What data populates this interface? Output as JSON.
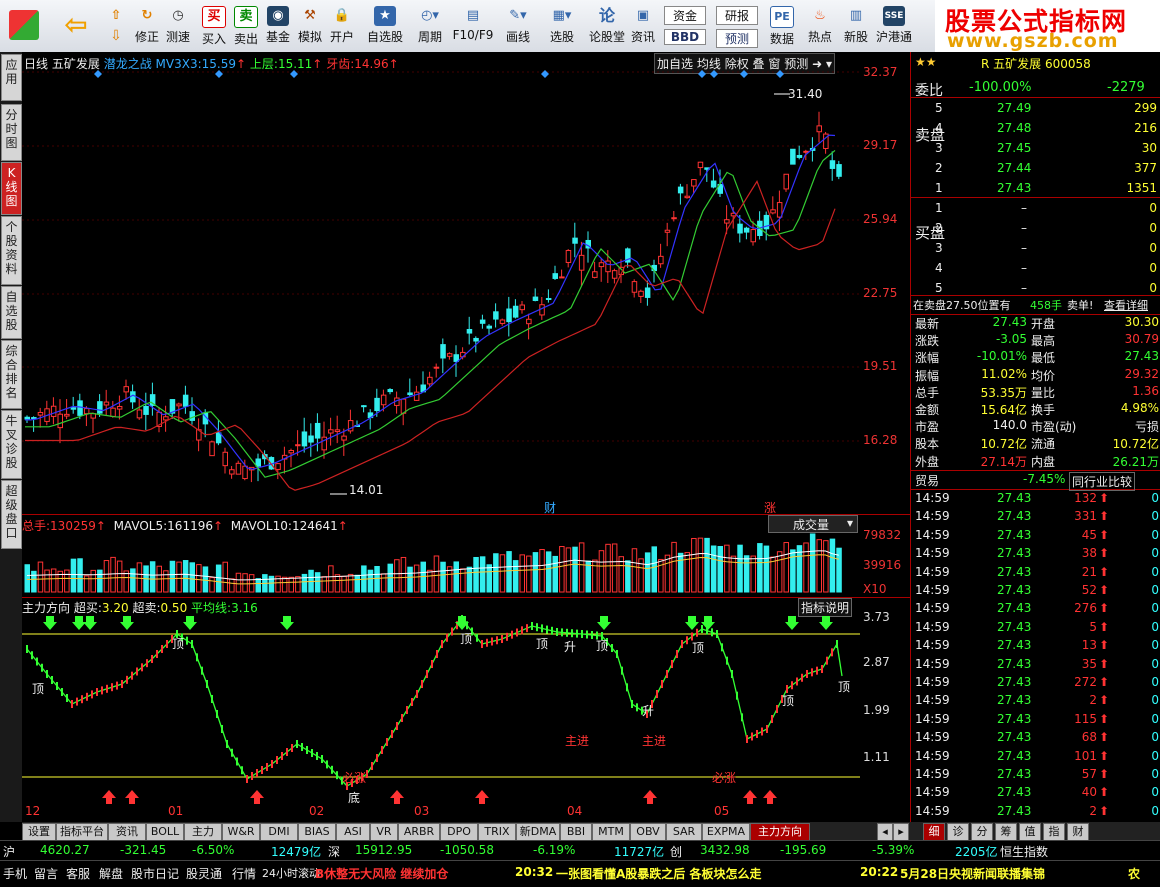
{
  "toolbar": {
    "buttons": [
      {
        "icon": "back-arrow-icon",
        "label": ""
      },
      {
        "icon": "up-down-icon",
        "label": ""
      },
      {
        "icon": "modify-icon",
        "label": "修正"
      },
      {
        "icon": "clock-icon",
        "label": "测速"
      },
      {
        "icon": "buy-icon",
        "label": "买入",
        "glyph": "买"
      },
      {
        "icon": "sell-icon",
        "label": "卖出",
        "glyph": "卖"
      },
      {
        "icon": "fund-icon",
        "label": "基金"
      },
      {
        "icon": "hammer-icon",
        "label": "模拟"
      },
      {
        "icon": "lock-icon",
        "label": "开户"
      },
      {
        "icon": "star-icon",
        "label": "自选股"
      },
      {
        "icon": "cycle-icon",
        "label": "周期"
      },
      {
        "icon": "f10-icon",
        "label": "F10/F9"
      },
      {
        "icon": "pen-icon",
        "label": "画线"
      },
      {
        "icon": "stock-select-icon",
        "label": "选股"
      },
      {
        "icon": "forum-icon",
        "label": "论股堂",
        "glyph": "论"
      },
      {
        "icon": "info-icon",
        "label": "资讯"
      },
      {
        "icon": "funds-icon",
        "label": "资金",
        "sub": "BBD"
      },
      {
        "icon": "research-icon",
        "label": "研报",
        "sub": "预测"
      },
      {
        "icon": "pe-icon",
        "label": "数据",
        "glyph": "PE"
      },
      {
        "icon": "hot-icon",
        "label": "热点"
      },
      {
        "icon": "new-stock-icon",
        "label": "新股"
      },
      {
        "icon": "hk-connect-icon",
        "label": "沪港通"
      }
    ]
  },
  "brand": {
    "title": "股票公式指标网",
    "url": "www.gszb.com"
  },
  "left_tabs": [
    "应用",
    "分时图",
    "K线图",
    "个股资料",
    "自选股",
    "综合排名",
    "牛叉诊股",
    "超级盘口"
  ],
  "chart": {
    "header": {
      "period": "日线",
      "stock_name": "五矿发展",
      "indicator": "潜龙之战",
      "ma_label": "MV3X3:",
      "ma_value": "15.59",
      "upper_label": "上层:",
      "upper_value": "15.11",
      "lower_label": "牙齿:",
      "lower_value": "14.96",
      "buttons": [
        "加自选",
        "均线",
        "除权",
        "叠",
        "窗",
        "预测"
      ]
    },
    "price_axis": [
      "32.37",
      "29.17",
      "25.94",
      "22.75",
      "19.51",
      "16.28"
    ],
    "high_marker": "31.40",
    "low_marker": "14.01",
    "event_markers": [
      "财",
      "涨"
    ],
    "volume": {
      "label": "总手:",
      "value": "130259",
      "mavol5_label": "MAVOL5:",
      "mavol5_value": "161196",
      "mavol10_label": "MAVOL10:",
      "mavol10_value": "124641",
      "dropdown": "成交量",
      "axis": [
        "79832",
        "39916",
        "X10"
      ]
    },
    "indicator_panel": {
      "name": "主力方向",
      "super_buy_label": "超买:",
      "super_buy_value": "3.20",
      "super_sell_label": "超卖:",
      "super_sell_value": "0.50",
      "avg_label": "平均线:",
      "avg_value": "3.16",
      "explain": "指标说明",
      "axis": [
        "3.73",
        "2.87",
        "1.99",
        "1.11"
      ],
      "top_label": "顶",
      "bottom_label": "底",
      "rise_label": "升",
      "in_label": "主进",
      "must_rise": "必涨"
    },
    "date_axis": [
      "12",
      "01",
      "02",
      "03",
      "04",
      "05"
    ]
  },
  "right_panel": {
    "title_stock": "R 五矿发展 600058",
    "weibi_label": "委比",
    "weibi_value": "-100.00%",
    "weicha_value": "-2279",
    "sell_label": "卖盘",
    "sell": [
      {
        "lvl": "5",
        "price": "27.49",
        "vol": "299"
      },
      {
        "lvl": "4",
        "price": "27.48",
        "vol": "216"
      },
      {
        "lvl": "3",
        "price": "27.45",
        "vol": "30"
      },
      {
        "lvl": "2",
        "price": "27.44",
        "vol": "377"
      },
      {
        "lvl": "1",
        "price": "27.43",
        "vol": "1351"
      }
    ],
    "buy_label": "买盘",
    "buy": [
      {
        "lvl": "1",
        "price": "–",
        "vol": "0"
      },
      {
        "lvl": "2",
        "price": "–",
        "vol": "0"
      },
      {
        "lvl": "3",
        "price": "–",
        "vol": "0"
      },
      {
        "lvl": "4",
        "price": "–",
        "vol": "0"
      },
      {
        "lvl": "5",
        "price": "–",
        "vol": "0"
      }
    ],
    "notice": "在卖盘27.50位置有",
    "notice_vol": "458手",
    "notice_tail": "卖单!",
    "notice_link": "查看详细",
    "stats": [
      [
        "最新",
        "27.43",
        "开盘",
        "30.30"
      ],
      [
        "涨跌",
        "-3.05",
        "最高",
        "30.79"
      ],
      [
        "涨幅",
        "-10.01%",
        "最低",
        "27.43"
      ],
      [
        "振幅",
        "11.02%",
        "均价",
        "29.32"
      ],
      [
        "总手",
        "53.35万",
        "量比",
        "1.36"
      ],
      [
        "金额",
        "15.64亿",
        "换手",
        "4.98%"
      ],
      [
        "市盈",
        "140.0",
        "市盈(动)",
        "亏损"
      ],
      [
        "股本",
        "10.72亿",
        "流通",
        "10.72亿"
      ],
      [
        "外盘",
        "27.14万",
        "内盘",
        "26.21万"
      ]
    ],
    "industry": "贸易",
    "industry_change": "-7.45%",
    "industry_link": "同行业比较",
    "ticks": [
      {
        "t": "14:59",
        "p": "27.43",
        "v": "132"
      },
      {
        "t": "14:59",
        "p": "27.43",
        "v": "331"
      },
      {
        "t": "14:59",
        "p": "27.43",
        "v": "45"
      },
      {
        "t": "14:59",
        "p": "27.43",
        "v": "38"
      },
      {
        "t": "14:59",
        "p": "27.43",
        "v": "21"
      },
      {
        "t": "14:59",
        "p": "27.43",
        "v": "52"
      },
      {
        "t": "14:59",
        "p": "27.43",
        "v": "276"
      },
      {
        "t": "14:59",
        "p": "27.43",
        "v": "5"
      },
      {
        "t": "14:59",
        "p": "27.43",
        "v": "13"
      },
      {
        "t": "14:59",
        "p": "27.43",
        "v": "35"
      },
      {
        "t": "14:59",
        "p": "27.43",
        "v": "272"
      },
      {
        "t": "14:59",
        "p": "27.43",
        "v": "2"
      },
      {
        "t": "14:59",
        "p": "27.43",
        "v": "115"
      },
      {
        "t": "14:59",
        "p": "27.43",
        "v": "68"
      },
      {
        "t": "14:59",
        "p": "27.43",
        "v": "101"
      },
      {
        "t": "14:59",
        "p": "27.43",
        "v": "57"
      },
      {
        "t": "14:59",
        "p": "27.43",
        "v": "40"
      },
      {
        "t": "14:59",
        "p": "27.43",
        "v": "2"
      }
    ],
    "bottom_tabs": [
      "细",
      "诊",
      "分",
      "筹",
      "值",
      "指",
      "财"
    ]
  },
  "bottom_tabs": [
    "设置",
    "指标平台",
    "资讯",
    "BOLL",
    "主力",
    "W&R",
    "DMI",
    "BIAS",
    "ASI",
    "VR",
    "ARBR",
    "DPO",
    "TRIX",
    "新DMA",
    "BBI",
    "MTM",
    "OBV",
    "SAR",
    "EXPMA",
    "主力方向"
  ],
  "index_bar": {
    "sh_label": "沪",
    "sh_value": "4620.27",
    "sh_change": "-321.45",
    "sh_pct": "-6.50%",
    "sh_amount": "12479亿",
    "sz_label": "深",
    "sz_value": "15912.95",
    "sz_change": "-1050.58",
    "sz_pct": "-6.19%",
    "sz_amount": "11727亿",
    "cy_label": "创",
    "cy_value": "3432.98",
    "cy_change": "-195.69",
    "cy_pct": "-5.39%",
    "cy_amount": "2205亿",
    "hs_label": "恒生指数"
  },
  "status_bar": {
    "items": [
      "手机",
      "留言",
      "客服",
      "解盘",
      "股市日记",
      "股灵通",
      "行情",
      "24小时滚动"
    ],
    "news1": "B休整无大风险 继续加仓",
    "news2_time": "20:32",
    "news2": "一张图看懂A股暴跌之后 各板块怎么走",
    "news3_time": "20:22",
    "news3": "5月28日央视新闻联播集锦",
    "tail": "农"
  }
}
